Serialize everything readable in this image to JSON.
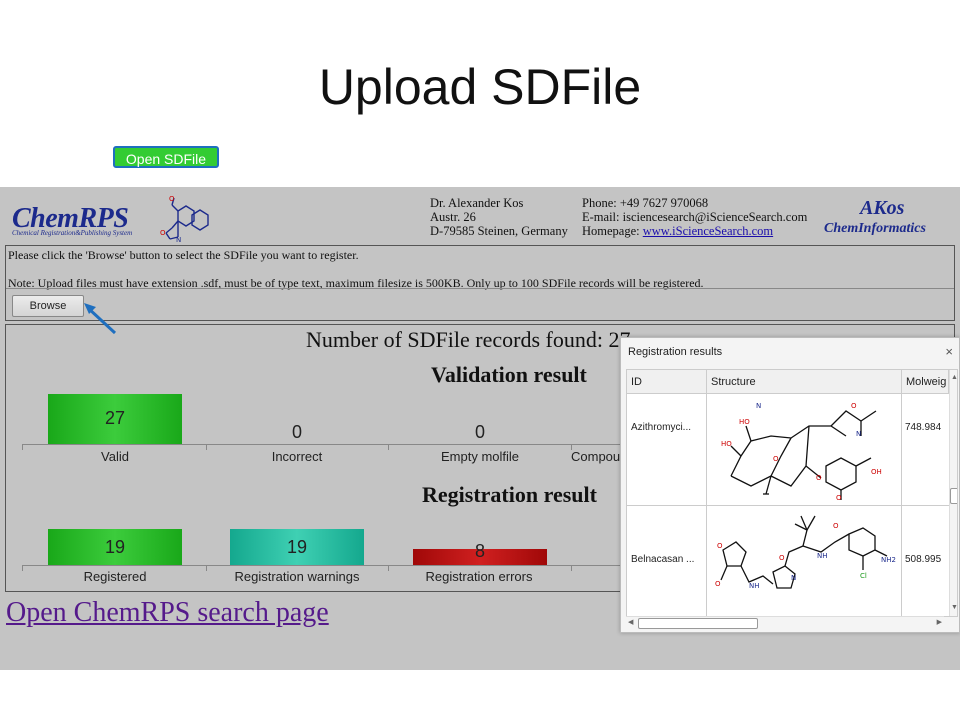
{
  "slide_title": "Upload SDFile",
  "header": {
    "logo_text": "ChemRPS",
    "logo_subtitle": "Chemical Registration&Publishing System",
    "address": [
      "Dr. Alexander Kos",
      "Austr. 26",
      "D-79585 Steinen, Germany"
    ],
    "phone": "Phone: +49 7627 970068",
    "email": "E-mail: isciencesearch@iScienceSearch.com",
    "homepage_label": "Homepage: ",
    "homepage_link": "www.iScienceSearch.com",
    "akos_top": "AKos",
    "akos_bottom": "ChemInformatics"
  },
  "instructions": {
    "line1": "Please click the 'Browse' button to select the SDFile you want to register.",
    "line2": "Note: Upload files must have extension .sdf, must be of type text, maximum filesize is 500KB. Only up to 100 SDFile records will be registered.",
    "browse_label": "Browse"
  },
  "callout": {
    "label": "Open SDFile"
  },
  "results": {
    "count_line": "Number of SDFile records found: 27",
    "validation_title": "Validation result",
    "registration_title": "Registration result"
  },
  "validation_bars": [
    {
      "label": "Valid",
      "value": "27",
      "color": "#22b022"
    },
    {
      "label": "Incorrect",
      "value": "0"
    },
    {
      "label": "Empty molfile",
      "value": "0"
    },
    {
      "label": "Compou"
    }
  ],
  "registration_bars": [
    {
      "label": "Registered",
      "value": "19",
      "color": "#22b022"
    },
    {
      "label": "Registration warnings",
      "value": "19",
      "color": "#1ab89a"
    },
    {
      "label": "Registration errors",
      "value": "8",
      "color": "#b01010"
    }
  ],
  "search_link": "Open ChemRPS search page",
  "dialog": {
    "title": "Registration results",
    "close": "×",
    "columns": [
      "ID",
      "Structure",
      "Molweig"
    ],
    "rows": [
      {
        "id": "Azithromyci...",
        "molweight": "748.984"
      },
      {
        "id": "Belnacasan ...",
        "molweight": "508.995"
      }
    ]
  }
}
